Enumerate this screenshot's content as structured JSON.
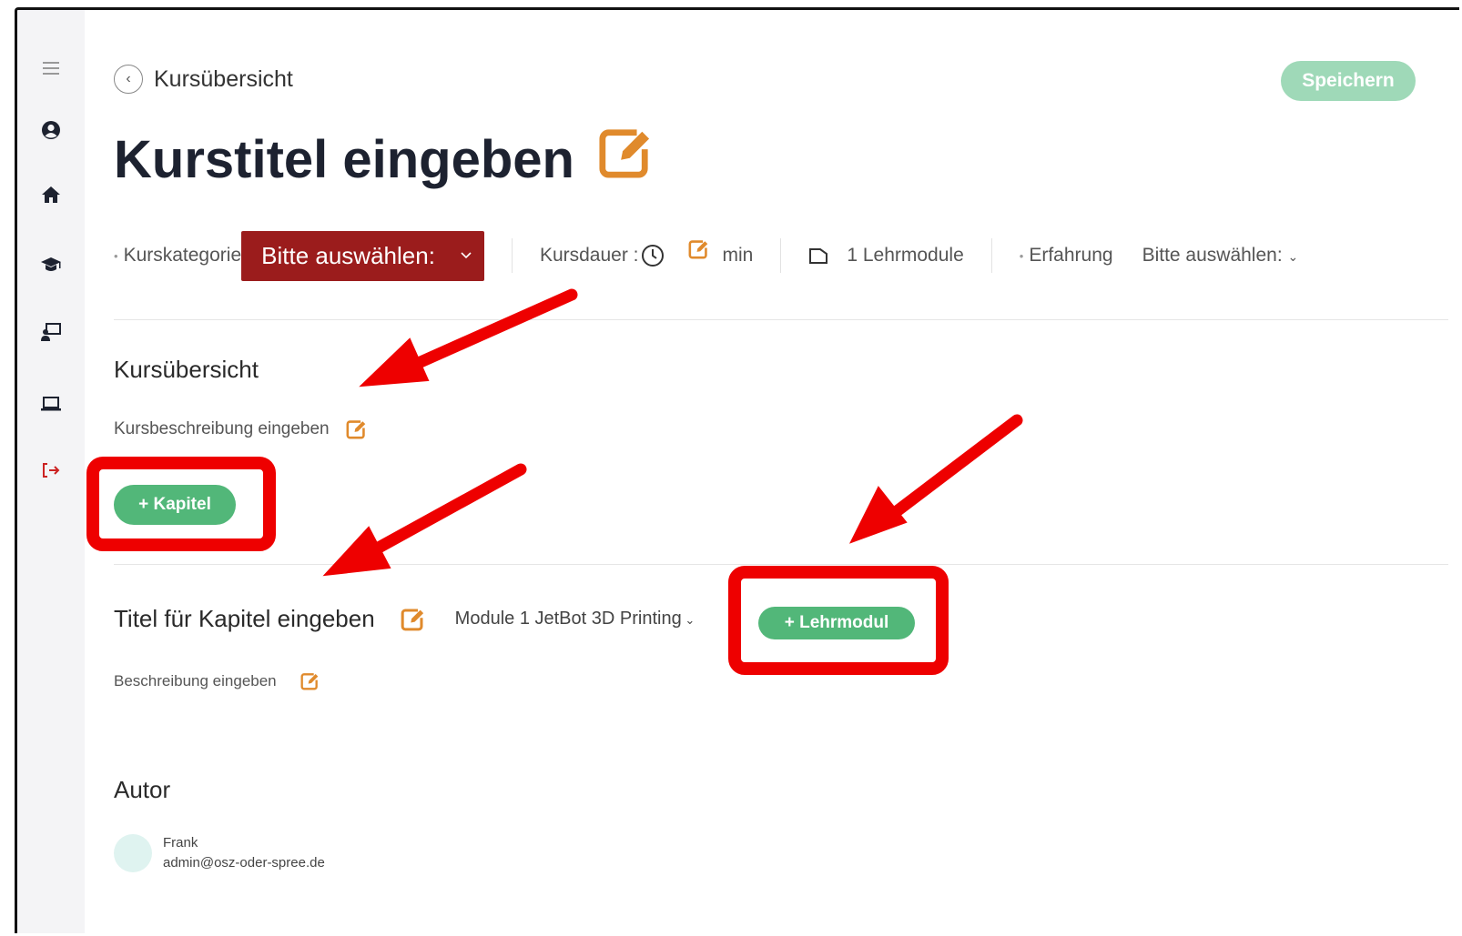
{
  "sidebar": {
    "items": [
      {
        "icon": "hamburger-menu-icon"
      },
      {
        "icon": "user-profile-icon"
      },
      {
        "icon": "home-icon"
      },
      {
        "icon": "graduation-cap-icon"
      },
      {
        "icon": "teacher-board-icon"
      },
      {
        "icon": "laptop-icon"
      },
      {
        "icon": "logout-icon"
      }
    ]
  },
  "header": {
    "breadcrumb": "Kursübersicht",
    "save_label": "Speichern",
    "title": "Kurstitel eingeben"
  },
  "meta": {
    "category_label": "Kurskategorie",
    "category_value": "Bitte auswählen:",
    "duration_label": "Kursdauer :",
    "duration_unit": "min",
    "modules_text": "1 Lehrmodule",
    "experience_label": "Erfahrung",
    "experience_value": "Bitte auswählen:"
  },
  "overview": {
    "heading": "Kursübersicht",
    "description_placeholder": "Kursbeschreibung eingeben",
    "add_chapter_label": "+ Kapitel"
  },
  "chapter": {
    "title_placeholder": "Titel für Kapitel eingeben",
    "module_select": "Module 1 JetBot 3D Printing",
    "add_module_label": "+ Lehrmodul",
    "description_placeholder": "Beschreibung eingeben"
  },
  "author": {
    "heading": "Autor",
    "name": "Frank",
    "email": "admin@osz-oder-spree.de"
  },
  "colors": {
    "accent_orange": "#e08a2c",
    "category_red": "#9b1c1c",
    "green_button": "#52b779",
    "save_disabled": "#9fd9b8",
    "annotation_red": "#ee0000"
  }
}
